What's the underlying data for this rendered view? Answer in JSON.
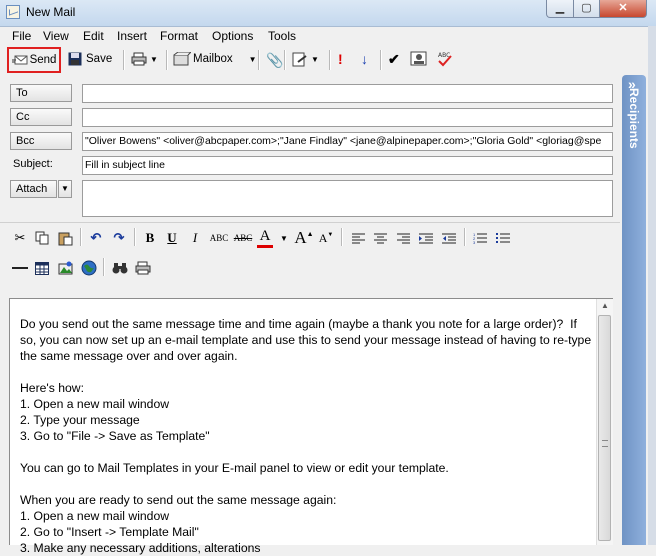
{
  "window": {
    "title": "New Mail",
    "close_glyph": "✕",
    "min_glyph": "▁",
    "max_glyph": "▢"
  },
  "menu": [
    "File",
    "View",
    "Edit",
    "Insert",
    "Format",
    "Options",
    "Tools"
  ],
  "toolbar": {
    "send_label": "Send",
    "save_label": "Save",
    "mailbox_label": "Mailbox",
    "send_highlight_color": "#e02020"
  },
  "address": {
    "to_label": "To",
    "cc_label": "Cc",
    "bcc_label": "Bcc",
    "bcc_value": "\"Oliver Bowens\" <oliver@abcpaper.com>;\"Jane Findlay\" <jane@alpinepaper.com>;\"Gloria Gold\" <gloriag@spe",
    "subject_label": "Subject:",
    "subject_value": "Fill in subject line",
    "attach_label": "Attach"
  },
  "format": {
    "bold": "B",
    "underline": "U",
    "italic": "I",
    "smallcaps": "ABC",
    "strike": "ABC",
    "fontcolor": "A"
  },
  "body": "Do you send out the same message time and time again (maybe a thank you note for a large order)?  If so, you can now set up an e-mail template and use this to send your message instead of having to re-type the same message over and over again.\n\nHere's how:\n1. Open a new mail window\n2. Type your message\n3. Go to \"File -> Save as Template\"\n\nYou can go to Mail Templates in your E-mail panel to view or edit your template.\n\nWhen you are ready to send out the same message again:\n1. Open a new mail window\n2. Go to \"Insert -> Template Mail\"\n3. Make any necessary additions, alterations",
  "side_panel": {
    "label": "Recipients",
    "arrow": "»"
  }
}
